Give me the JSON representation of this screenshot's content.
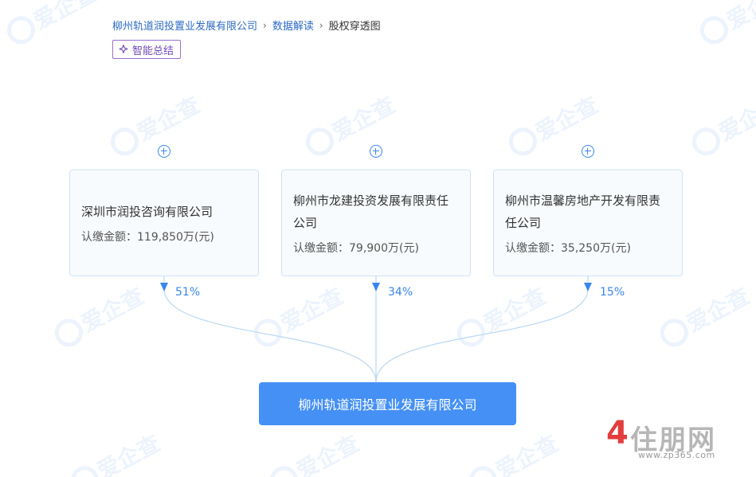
{
  "breadcrumb": {
    "company": "柳州轨道润投置业发展有限公司",
    "section": "数据解读",
    "current": "股权穿透图"
  },
  "smart_summary_label": "智能总结",
  "watermark_text": "爱企查",
  "shareholders": [
    {
      "name": "深圳市润投咨询有限公司",
      "amount_label": "认缴金额：",
      "amount": "119,850万(元)",
      "percent": "51%"
    },
    {
      "name": "柳州市龙建投资发展有限责任公司",
      "amount_label": "认缴金额：",
      "amount": "79,900万(元)",
      "percent": "34%"
    },
    {
      "name": "柳州市温馨房地产开发有限责任公司",
      "amount_label": "认缴金额：",
      "amount": "35,250万(元)",
      "percent": "15%"
    }
  ],
  "target_company": "柳州轨道润投置业发展有限公司",
  "brand": {
    "red": "4",
    "grey": "住朋网",
    "url": "www.zp365.com"
  },
  "colors": {
    "accent": "#3a86f0",
    "target_bg": "#4590f5",
    "card_border": "#cfe3f8",
    "summary_purple": "#6f49b6"
  }
}
